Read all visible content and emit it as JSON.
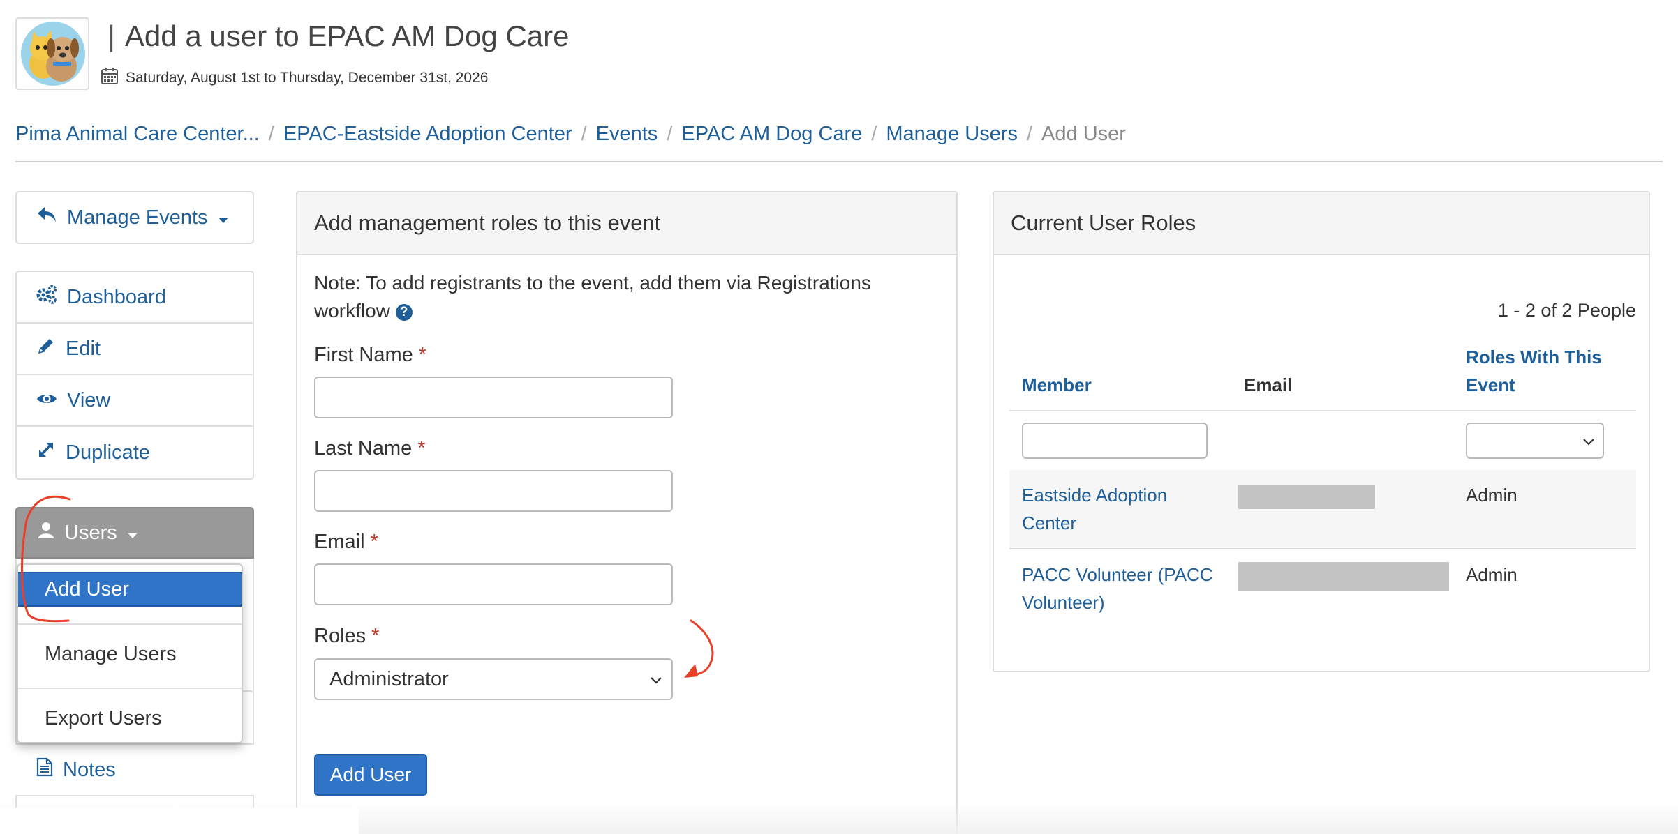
{
  "header": {
    "title": "Add a user to EPAC AM Dog Care",
    "divider": "|",
    "date_range": "Saturday, August 1st to Thursday, December 31st, 2026",
    "calendar_icon": "calendar-icon",
    "logo_icon": "cat-and-dog-logo"
  },
  "breadcrumb": [
    {
      "label": "Pima Animal Care Center..."
    },
    {
      "label": "EPAC-Eastside Adoption Center"
    },
    {
      "label": "Events"
    },
    {
      "label": "EPAC AM Dog Care"
    },
    {
      "label": "Manage Users"
    },
    {
      "label": "Add User",
      "active": true
    }
  ],
  "sidebar": {
    "manage_events": {
      "label": "Manage Events",
      "icon": "reply-icon"
    },
    "items": [
      {
        "label": "Dashboard",
        "icon": "gears-icon"
      },
      {
        "label": "Edit",
        "icon": "pencil-icon"
      },
      {
        "label": "View",
        "icon": "eye-icon"
      },
      {
        "label": "Duplicate",
        "icon": "expand-icon"
      }
    ],
    "users": {
      "label": "Users",
      "icon": "user-icon"
    },
    "notes": {
      "label": "Notes",
      "icon": "document-icon"
    }
  },
  "users_menu": {
    "items": [
      {
        "label": "Add User",
        "active": true
      },
      {
        "label": "Manage Users"
      },
      {
        "label": "Export Users"
      }
    ]
  },
  "form": {
    "heading": "Add management roles to this event",
    "note": "Note: To add registrants to the event, add them via Registrations workflow",
    "help_icon": "question-circle-icon",
    "first_name": {
      "label": "First Name",
      "required": "*",
      "value": ""
    },
    "last_name": {
      "label": "Last Name",
      "required": "*",
      "value": ""
    },
    "email": {
      "label": "Email",
      "required": "*",
      "value": ""
    },
    "roles": {
      "label": "Roles",
      "required": "*",
      "selected": "Administrator"
    },
    "submit": "Add User"
  },
  "roles_panel": {
    "heading": "Current User Roles",
    "count": "1 - 2 of 2 People",
    "columns": {
      "member": "Member",
      "email": "Email",
      "roles_line1": "Roles With This",
      "roles_line2": "Event"
    },
    "filter": {
      "member": "",
      "roles": ""
    },
    "rows": [
      {
        "member_line1": "Eastside Adoption",
        "member_line2": "Center",
        "email": "",
        "role": "Admin"
      },
      {
        "member_line1": "PACC Volunteer (PACC",
        "member_line2": "Volunteer)",
        "email": "",
        "role": "Admin"
      }
    ]
  },
  "colors": {
    "link": "#1f5f99",
    "primary": "#2f74c6",
    "required": "#c0392b",
    "annotation": "#e8402a"
  }
}
